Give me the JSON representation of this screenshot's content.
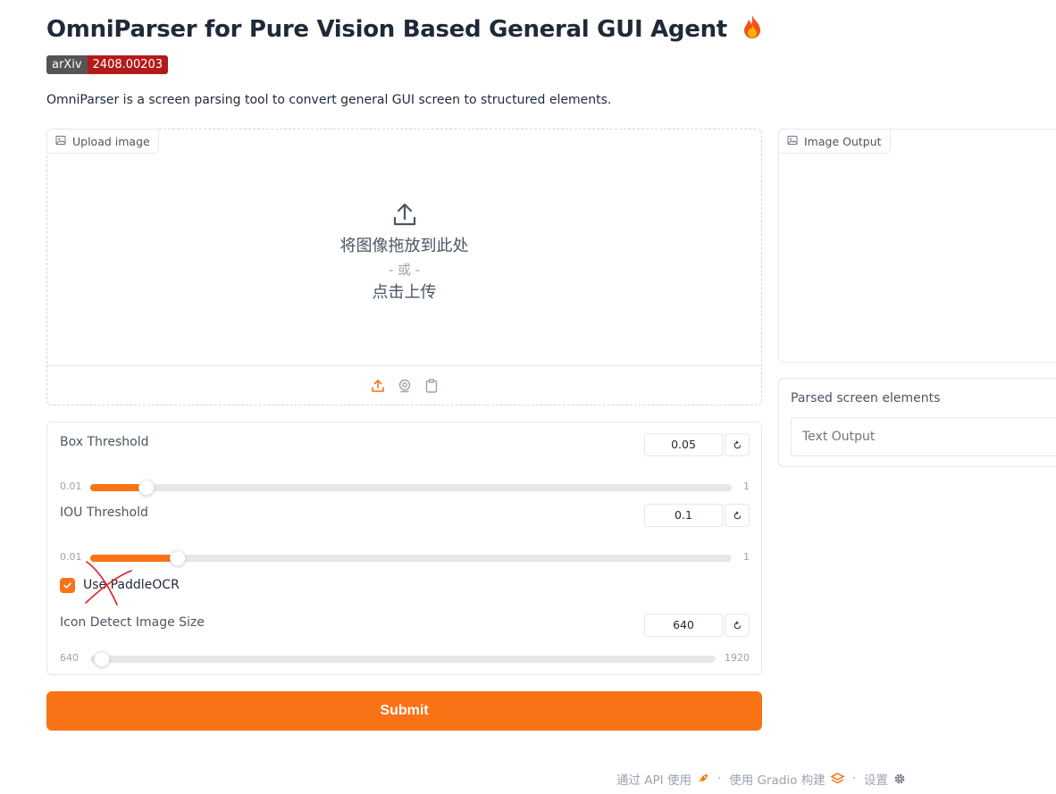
{
  "header": {
    "title": "OmniParser for Pure Vision Based General GUI Agent",
    "badge_left": "arXiv",
    "badge_right": "2408.00203",
    "description": "OmniParser is a screen parsing tool to convert general GUI screen to structured elements."
  },
  "upload": {
    "label": "Upload image",
    "drop_text": "将图像拖放到此处",
    "or_text": "- 或 -",
    "click_text": "点击上传"
  },
  "controls": {
    "box_threshold": {
      "label": "Box Threshold",
      "value": "0.05",
      "min": "0.01",
      "max": "1",
      "fraction": 0.05
    },
    "iou_threshold": {
      "label": "IOU Threshold",
      "value": "0.1",
      "min": "0.01",
      "max": "1",
      "fraction": 0.1
    },
    "use_paddle": {
      "label": "Use PaddleOCR",
      "checked": true
    },
    "icon_size": {
      "label": "Icon Detect Image Size",
      "value": "640",
      "min": "640",
      "max": "1920",
      "fraction": 0.0
    }
  },
  "submit_label": "Submit",
  "output": {
    "image_label": "Image Output",
    "parsed_label": "Parsed screen elements",
    "text_placeholder": "Text Output"
  },
  "footer": {
    "api": "通过 API 使用",
    "gradio": "使用 Gradio 构建",
    "settings": "设置"
  },
  "colors": {
    "accent": "#f97316",
    "arxiv_red": "#b31b1b",
    "arxiv_grey": "#555555"
  }
}
